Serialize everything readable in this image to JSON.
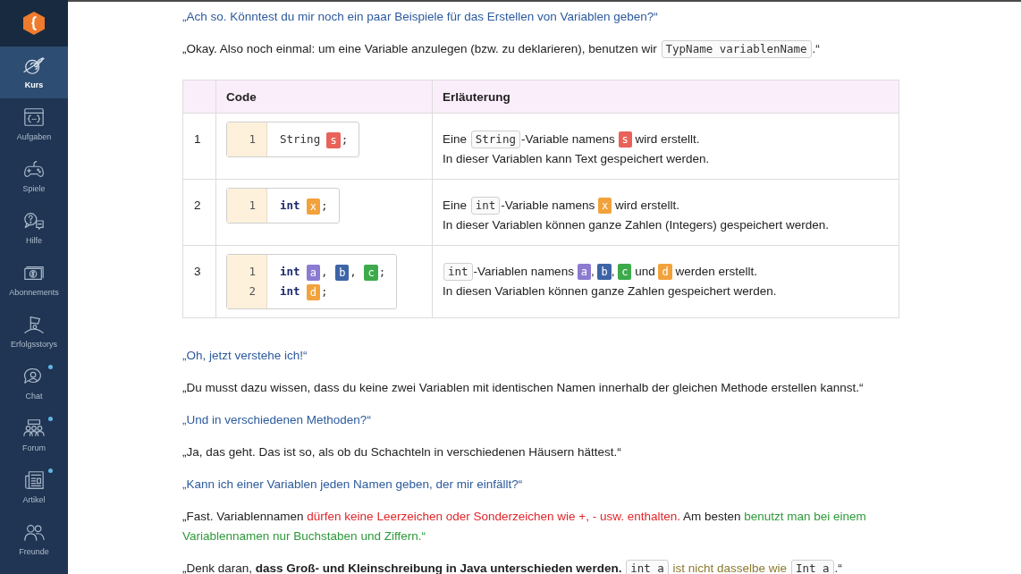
{
  "sidebar": {
    "items": [
      {
        "label": "Kurs",
        "selected": true,
        "notification": false
      },
      {
        "label": "Aufgaben",
        "selected": false,
        "notification": false
      },
      {
        "label": "Spiele",
        "selected": false,
        "notification": false
      },
      {
        "label": "Hilfe",
        "selected": false,
        "notification": false
      },
      {
        "label": "Abonnements",
        "selected": false,
        "notification": false
      },
      {
        "label": "Erfolgsstorys",
        "selected": false,
        "notification": false
      },
      {
        "label": "Chat",
        "selected": false,
        "notification": true
      },
      {
        "label": "Forum",
        "selected": false,
        "notification": true
      },
      {
        "label": "Artikel",
        "selected": false,
        "notification": true
      },
      {
        "label": "Freunde",
        "selected": false,
        "notification": false
      }
    ]
  },
  "content": [
    {
      "kind": "question",
      "parts": [
        {
          "kind": "text",
          "text": "„Ach so. Könntest du mir noch ein paar Beispiele für das Erstellen von Variablen geben?“"
        }
      ]
    },
    {
      "kind": "answer",
      "parts": [
        {
          "kind": "text",
          "text": "„Okay. Also noch einmal: um eine Variable anzulegen (bzw. zu deklarieren), benutzen wir "
        },
        {
          "kind": "code",
          "text": "TypName variablenName"
        },
        {
          "kind": "text",
          "text": ".“"
        }
      ]
    },
    {
      "kind": "table",
      "columns": [
        "Code",
        "Erläuterung"
      ],
      "rows": [
        {
          "number": "1",
          "code": [
            {
              "line_number": "1",
              "parts": [
                {
                  "kind": "type",
                  "text": "String"
                },
                {
                  "kind": "var",
                  "text": "s",
                  "color": "#e8625a"
                },
                {
                  "kind": "text",
                  "text": ";"
                }
              ]
            }
          ],
          "explanation": [
            {
              "parts": [
                {
                  "kind": "text",
                  "text": "Eine "
                },
                {
                  "kind": "code",
                  "text": "String"
                },
                {
                  "kind": "text",
                  "text": "-Variable namens "
                },
                {
                  "kind": "var",
                  "text": "s",
                  "color": "#e8625a"
                },
                {
                  "kind": "text",
                  "text": " wird erstellt."
                }
              ]
            },
            {
              "parts": [
                {
                  "kind": "text",
                  "text": "In dieser Variablen kann Text gespeichert werden."
                }
              ]
            }
          ]
        },
        {
          "number": "2",
          "code": [
            {
              "line_number": "1",
              "parts": [
                {
                  "kind": "keyword",
                  "text": "int"
                },
                {
                  "kind": "var",
                  "text": "x",
                  "color": "#f2a23c"
                },
                {
                  "kind": "text",
                  "text": ";"
                }
              ]
            }
          ],
          "explanation": [
            {
              "parts": [
                {
                  "kind": "text",
                  "text": "Eine "
                },
                {
                  "kind": "code",
                  "text": "int"
                },
                {
                  "kind": "text",
                  "text": "-Variable namens "
                },
                {
                  "kind": "var",
                  "text": "x",
                  "color": "#f2a23c"
                },
                {
                  "kind": "text",
                  "text": " wird erstellt."
                }
              ]
            },
            {
              "parts": [
                {
                  "kind": "text",
                  "text": "In dieser Variablen können ganze Zahlen (Integers) gespeichert werden."
                }
              ]
            }
          ]
        },
        {
          "number": "3",
          "code": [
            {
              "line_number": "1",
              "parts": [
                {
                  "kind": "keyword",
                  "text": "int"
                },
                {
                  "kind": "var",
                  "text": "a",
                  "color": "#8c7bd1"
                },
                {
                  "kind": "text",
                  "text": ", "
                },
                {
                  "kind": "var",
                  "text": "b",
                  "color": "#3d64a6"
                },
                {
                  "kind": "text",
                  "text": ", "
                },
                {
                  "kind": "var",
                  "text": "c",
                  "color": "#3daa4b"
                },
                {
                  "kind": "text",
                  "text": ";"
                }
              ]
            },
            {
              "line_number": "2",
              "parts": [
                {
                  "kind": "keyword",
                  "text": "int"
                },
                {
                  "kind": "var",
                  "text": "d",
                  "color": "#f2a23c"
                },
                {
                  "kind": "text",
                  "text": ";"
                }
              ]
            }
          ],
          "explanation": [
            {
              "parts": [
                {
                  "kind": "code",
                  "text": "int"
                },
                {
                  "kind": "text",
                  "text": "-Variablen namens "
                },
                {
                  "kind": "var",
                  "text": "a",
                  "color": "#8c7bd1"
                },
                {
                  "kind": "text",
                  "text": ", "
                },
                {
                  "kind": "var",
                  "text": "b",
                  "color": "#3d64a6"
                },
                {
                  "kind": "text",
                  "text": ", "
                },
                {
                  "kind": "var",
                  "text": "c",
                  "color": "#3daa4b"
                },
                {
                  "kind": "text",
                  "text": " und "
                },
                {
                  "kind": "var",
                  "text": "d",
                  "color": "#f2a23c"
                },
                {
                  "kind": "text",
                  "text": " werden erstellt."
                }
              ]
            },
            {
              "parts": [
                {
                  "kind": "text",
                  "text": "In diesen Variablen können ganze Zahlen gespeichert werden."
                }
              ]
            }
          ]
        }
      ]
    },
    {
      "kind": "question",
      "parts": [
        {
          "kind": "text",
          "text": "„Oh, jetzt verstehe ich!“"
        }
      ]
    },
    {
      "kind": "answer",
      "parts": [
        {
          "kind": "text",
          "text": "„Du musst dazu wissen, dass du keine zwei Variablen mit identischen Namen innerhalb der gleichen Methode erstellen kannst.“"
        }
      ]
    },
    {
      "kind": "question",
      "parts": [
        {
          "kind": "text",
          "text": "„Und in verschiedenen Methoden?“"
        }
      ]
    },
    {
      "kind": "answer",
      "parts": [
        {
          "kind": "text",
          "text": "„Ja, das geht. Das ist so, als ob du Schachteln in verschiedenen Häusern hättest.“"
        }
      ]
    },
    {
      "kind": "question",
      "parts": [
        {
          "kind": "text",
          "text": "„Kann ich einer Variablen jeden Namen geben, der mir einfällt?“"
        }
      ]
    },
    {
      "kind": "answer",
      "parts": [
        {
          "kind": "text",
          "text": "„Fast. Variablennamen "
        },
        {
          "kind": "warning",
          "text": "dürfen keine Leerzeichen oder Sonderzeichen wie +, - usw. enthalten."
        },
        {
          "kind": "text",
          "text": " Am besten "
        },
        {
          "kind": "hint",
          "text": "benutzt man bei einem Variablennamen nur Buchstaben und Ziffern.“"
        }
      ]
    },
    {
      "kind": "answer",
      "parts": [
        {
          "kind": "text",
          "text": "„Denk daran, **dass Groß- und Kleinschreibung in Java unterschieden werden.** "
        },
        {
          "kind": "code",
          "text": "int a"
        },
        {
          "kind": "note",
          "text": " ist nicht dasselbe wie "
        },
        {
          "kind": "code",
          "text": "Int a"
        },
        {
          "kind": "text",
          "text": ".“"
        }
      ]
    }
  ]
}
